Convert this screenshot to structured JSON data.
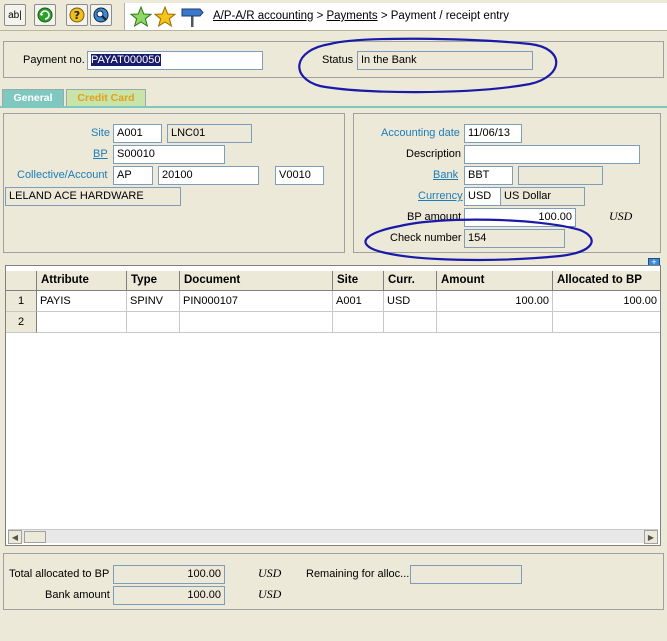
{
  "toolbar": {
    "abl_label": "ab|",
    "breadcrumb": {
      "item1": "A/P-A/R accounting",
      "sep1": ">",
      "item2": "Payments",
      "sep2": ">",
      "item3": "Payment / receipt entry"
    }
  },
  "header": {
    "payment_no_label": "Payment no.",
    "payment_no_value": "PAYAT000050",
    "status_label": "Status",
    "status_value": "In the Bank"
  },
  "tabs": [
    {
      "label": "General",
      "active": true
    },
    {
      "label": "Credit Card",
      "active": false
    }
  ],
  "left_panel": {
    "site_label": "Site",
    "site_value": "A001",
    "site_desc": "LNC01",
    "bp_label": "BP",
    "bp_value": "S00010",
    "coll_label": "Collective/Account",
    "coll_value1": "AP",
    "coll_value2": "20100",
    "coll_value3": "V0010",
    "bp_name": "LELAND ACE HARDWARE"
  },
  "right_panel": {
    "acc_date_label": "Accounting date",
    "acc_date_value": "11/06/13",
    "description_label": "Description",
    "description_value": "",
    "bank_label": "Bank",
    "bank_value": "BBT",
    "bank_desc": "",
    "currency_label": "Currency",
    "currency_value": "USD",
    "currency_desc": "US Dollar",
    "bp_amount_label": "BP amount",
    "bp_amount_value": "100.00",
    "bp_amount_currency": "USD",
    "check_number_label": "Check number",
    "check_number_value": "154"
  },
  "grid": {
    "columns": [
      "Attribute",
      "Type",
      "Document",
      "Site",
      "Curr.",
      "Amount",
      "Allocated to BP"
    ],
    "rows": [
      {
        "num": "1",
        "cells": [
          "PAYIS",
          "SPINV",
          "PIN000107",
          "A001",
          "USD",
          "100.00",
          "100.00"
        ]
      },
      {
        "num": "2",
        "cells": [
          "",
          "",
          "",
          "",
          "",
          "",
          ""
        ]
      }
    ]
  },
  "footer": {
    "total_allocated_label": "Total allocated to BP",
    "total_allocated_value": "100.00",
    "total_allocated_currency": "USD",
    "remaining_label": "Remaining for alloc...",
    "remaining_value": "",
    "bank_amount_label": "Bank amount",
    "bank_amount_value": "100.00",
    "bank_amount_currency": "USD"
  },
  "colors": {
    "link_blue": "#1c7cb8",
    "annotation_ink": "#1a1aa8",
    "general_tab": "#7fc8c0",
    "credit_card_tab": "#c9e4a8"
  },
  "icons": [
    "text-field-icon",
    "refresh-icon",
    "help-icon",
    "zoom-icon",
    "green-star-icon",
    "gold-star-icon",
    "signpost-icon",
    "expand-icon"
  ]
}
